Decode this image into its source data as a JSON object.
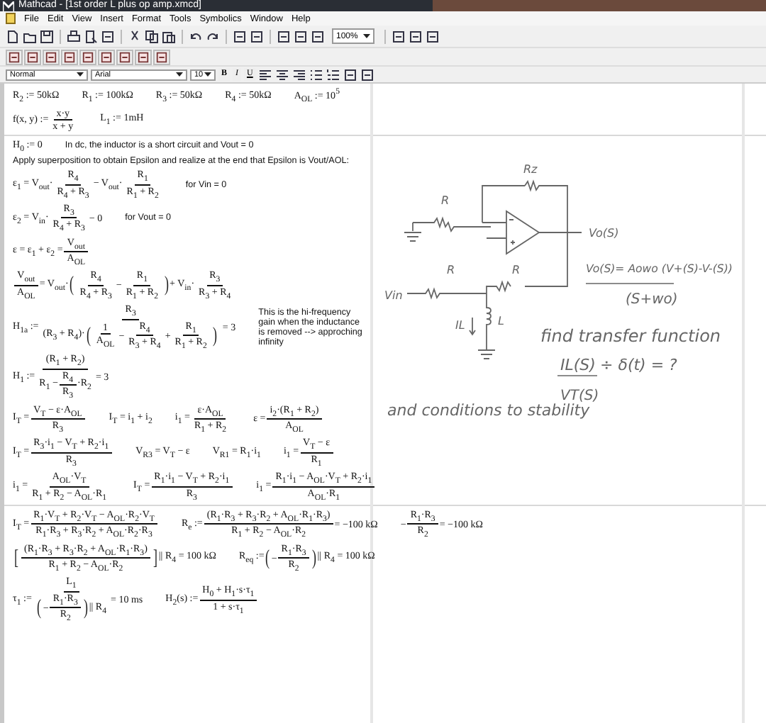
{
  "window": {
    "title": "Mathcad - [1st order L plus op amp.xmcd]"
  },
  "menu": [
    "File",
    "Edit",
    "View",
    "Insert",
    "Format",
    "Tools",
    "Symbolics",
    "Window",
    "Help"
  ],
  "toolbar": {
    "zoom": "100%"
  },
  "format_bar": {
    "style": "Normal",
    "font": "Arial",
    "size": "10",
    "bold": "B",
    "italic": "I",
    "underline": "U"
  },
  "worksheet": {
    "rows": [
      {
        "kind": "row",
        "groups": [
          {
            "kind": "math",
            "parts": [
              {
                "kind": "text",
                "text": "R$_{2}$ := 50kΩ"
              }
            ]
          },
          {
            "kind": "math",
            "parts": [
              {
                "kind": "text",
                "text": "R$_{1}$ := 100kΩ"
              }
            ]
          },
          {
            "kind": "math",
            "parts": [
              {
                "kind": "text",
                "text": "R$_{3}$ := 50kΩ"
              }
            ]
          },
          {
            "kind": "math",
            "parts": [
              {
                "kind": "text",
                "text": "R$_{4}$ := 50kΩ"
              }
            ]
          },
          {
            "kind": "math",
            "parts": [
              {
                "kind": "text",
                "text": "A$_{OL}$ := 10$^{5}$"
              }
            ]
          }
        ]
      },
      {
        "kind": "row",
        "groups": [
          {
            "kind": "math",
            "parts": [
              {
                "kind": "text",
                "text": "f(x, y) := "
              },
              {
                "kind": "frac",
                "num": "x·y",
                "den": "x + y"
              }
            ]
          },
          {
            "kind": "math",
            "parts": [
              {
                "kind": "text",
                "text": "L$_{1}$ := 1mH"
              }
            ]
          }
        ]
      },
      {
        "kind": "break"
      },
      {
        "kind": "row",
        "groups": [
          {
            "kind": "math",
            "parts": [
              {
                "kind": "text",
                "text": "H$_{0}$ := 0"
              }
            ]
          },
          {
            "kind": "note",
            "text": "In dc, the inductor is a short circuit and Vout = 0"
          }
        ]
      },
      {
        "kind": "row",
        "groups": [
          {
            "kind": "note",
            "text": "Apply superposition to obtain Epsilon and realize at the end that Epsilon is Vout/AOL:"
          }
        ]
      },
      {
        "kind": "row",
        "groups": [
          {
            "kind": "math",
            "parts": [
              {
                "kind": "text",
                "text": "ε$_{1}$ = V$_{out}$·"
              },
              {
                "kind": "frac",
                "num": "R$_{4}$",
                "den": "R$_{4}$ + R$_{3}$"
              },
              {
                "kind": "text",
                "text": " − V$_{out}$·"
              },
              {
                "kind": "frac",
                "num": "R$_{1}$",
                "den": "R$_{1}$ + R$_{2}$"
              }
            ]
          },
          {
            "kind": "note",
            "text": "for Vin = 0"
          }
        ]
      },
      {
        "kind": "row",
        "groups": [
          {
            "kind": "math",
            "parts": [
              {
                "kind": "text",
                "text": "ε$_{2}$ = V$_{in}$·"
              },
              {
                "kind": "frac",
                "num": "R$_{3}$",
                "den": "R$_{4}$ + R$_{3}$"
              },
              {
                "kind": "text",
                "text": " − 0"
              }
            ]
          },
          {
            "kind": "note",
            "text": "for Vout = 0"
          }
        ]
      },
      {
        "kind": "row",
        "groups": [
          {
            "kind": "math",
            "parts": [
              {
                "kind": "text",
                "text": "ε = ε$_{1}$ + ε$_{2}$ = "
              },
              {
                "kind": "frac",
                "num": "V$_{out}$",
                "den": "A$_{OL}$"
              }
            ]
          }
        ]
      },
      {
        "kind": "row",
        "groups": [
          {
            "kind": "math",
            "parts": [
              {
                "kind": "frac",
                "num": "V$_{out}$",
                "den": "A$_{OL}$"
              },
              {
                "kind": "text",
                "text": " = V$_{out}$·"
              },
              {
                "kind": "paren",
                "text": "("
              },
              {
                "kind": "frac",
                "num": "R$_{4}$",
                "den": "R$_{4}$ + R$_{3}$"
              },
              {
                "kind": "text",
                "text": " − "
              },
              {
                "kind": "frac",
                "num": "R$_{1}$",
                "den": "R$_{1}$ + R$_{2}$"
              },
              {
                "kind": "paren",
                "text": ")"
              },
              {
                "kind": "text",
                "text": " + V$_{in}$·"
              },
              {
                "kind": "frac",
                "num": "R$_{3}$",
                "den": "R$_{3}$ + R$_{4}$"
              }
            ]
          }
        ]
      },
      {
        "kind": "row",
        "groups": [
          {
            "kind": "math",
            "parts": [
              {
                "kind": "text",
                "text": "H$_{1a}$ := "
              },
              {
                "kind": "frac",
                "num": "R$_{3}$",
                "den": [
                  {
                    "kind": "text",
                    "text": "(R$_{3}$ + R$_{4}$)·"
                  },
                  {
                    "kind": "paren",
                    "text": "("
                  },
                  {
                    "kind": "frac",
                    "num": "1",
                    "den": "A$_{OL}$"
                  },
                  {
                    "kind": "text",
                    "text": " − "
                  },
                  {
                    "kind": "frac",
                    "num": "R$_{4}$",
                    "den": "R$_{3}$ + R$_{4}$"
                  },
                  {
                    "kind": "text",
                    "text": " + "
                  },
                  {
                    "kind": "frac",
                    "num": "R$_{1}$",
                    "den": "R$_{1}$ + R$_{2}$"
                  },
                  {
                    "kind": "paren",
                    "text": ")"
                  }
                ]
              },
              {
                "kind": "text",
                "text": " = 3"
              }
            ]
          },
          {
            "kind": "note",
            "text": "This is the hi-frequency gain when the inductance is removed --> approching infinity"
          }
        ]
      },
      {
        "kind": "row",
        "groups": [
          {
            "kind": "math",
            "parts": [
              {
                "kind": "text",
                "text": "H$_{1}$ := "
              },
              {
                "kind": "frac",
                "num": "(R$_{1}$ + R$_{2}$)",
                "den": [
                  {
                    "kind": "text",
                    "text": "R$_{1}$ − "
                  },
                  {
                    "kind": "frac",
                    "num": "R$_{4}$",
                    "den": "R$_{3}$"
                  },
                  {
                    "kind": "text",
                    "text": "·R$_{2}$"
                  }
                ]
              },
              {
                "kind": "text",
                "text": " = 3"
              }
            ]
          }
        ]
      },
      {
        "kind": "row",
        "groups": [
          {
            "kind": "math",
            "parts": [
              {
                "kind": "text",
                "text": "I$_{T}$ = "
              },
              {
                "kind": "frac",
                "num": "V$_{T}$ − ε·A$_{OL}$",
                "den": "R$_{3}$"
              }
            ]
          },
          {
            "kind": "math",
            "parts": [
              {
                "kind": "text",
                "text": "I$_{T}$ = i$_{1}$ + i$_{2}$"
              }
            ]
          },
          {
            "kind": "math",
            "parts": [
              {
                "kind": "text",
                "text": "i$_{1}$ = "
              },
              {
                "kind": "frac",
                "num": "ε·A$_{OL}$",
                "den": "R$_{1}$ + R$_{2}$"
              }
            ]
          },
          {
            "kind": "math",
            "parts": [
              {
                "kind": "text",
                "text": "ε = "
              },
              {
                "kind": "frac",
                "num": "i$_{2}$·(R$_{1}$ + R$_{2}$)",
                "den": "A$_{OL}$"
              }
            ]
          }
        ]
      },
      {
        "kind": "row",
        "groups": [
          {
            "kind": "math",
            "parts": [
              {
                "kind": "text",
                "text": "I$_{T}$ = "
              },
              {
                "kind": "frac",
                "num": "R$_{3}$·i$_{1}$ − V$_{T}$ + R$_{2}$·i$_{1}$",
                "den": "R$_{3}$"
              }
            ]
          },
          {
            "kind": "math",
            "parts": [
              {
                "kind": "text",
                "text": "V$_{R3}$ = V$_{T}$ − ε"
              }
            ]
          },
          {
            "kind": "math",
            "parts": [
              {
                "kind": "text",
                "text": "V$_{R1}$ = R$_{1}$·i$_{1}$"
              }
            ]
          },
          {
            "kind": "math",
            "parts": [
              {
                "kind": "text",
                "text": "i$_{1}$ = "
              },
              {
                "kind": "frac",
                "num": "V$_{T}$ − ε",
                "den": "R$_{1}$"
              }
            ]
          }
        ]
      },
      {
        "kind": "row",
        "groups": [
          {
            "kind": "math",
            "parts": [
              {
                "kind": "text",
                "text": "i$_{1}$ = "
              },
              {
                "kind": "frac",
                "num": "A$_{OL}$·V$_{T}$",
                "den": "R$_{1}$ + R$_{2}$ − A$_{OL}$·R$_{1}$"
              }
            ]
          },
          {
            "kind": "math",
            "parts": [
              {
                "kind": "text",
                "text": "I$_{T}$ = "
              },
              {
                "kind": "frac",
                "num": "R$_{1}$·i$_{1}$ − V$_{T}$ + R$_{2}$·i$_{1}$",
                "den": "R$_{3}$"
              }
            ]
          },
          {
            "kind": "math",
            "parts": [
              {
                "kind": "text",
                "text": "i$_{1}$ = "
              },
              {
                "kind": "frac",
                "num": "R$_{1}$·i$_{1}$ − A$_{OL}$·V$_{T}$ + R$_{2}$·i$_{1}$",
                "den": "A$_{OL}$·R$_{1}$"
              }
            ]
          }
        ]
      },
      {
        "kind": "break"
      },
      {
        "kind": "row",
        "groups": [
          {
            "kind": "math",
            "parts": [
              {
                "kind": "text",
                "text": "I$_{T}$ = "
              },
              {
                "kind": "frac",
                "num": "R$_{1}$·V$_{T}$ + R$_{2}$·V$_{T}$ − A$_{OL}$·R$_{2}$·V$_{T}$",
                "den": "R$_{1}$·R$_{3}$ + R$_{3}$·R$_{2}$ + A$_{OL}$·R$_{2}$·R$_{3}$"
              }
            ]
          },
          {
            "kind": "math",
            "parts": [
              {
                "kind": "text",
                "text": "R$_{e}$ := "
              },
              {
                "kind": "frac",
                "num": "(R$_{1}$·R$_{3}$ + R$_{3}$·R$_{2}$ + A$_{OL}$·R$_{1}$·R$_{3}$)",
                "den": "R$_{1}$ + R$_{2}$ − A$_{OL}$·R$_{2}$"
              },
              {
                "kind": "text",
                "text": " = −100 kΩ"
              }
            ]
          },
          {
            "kind": "math",
            "parts": [
              {
                "kind": "text",
                "text": "−"
              },
              {
                "kind": "frac",
                "num": "R$_{1}$·R$_{3}$",
                "den": "R$_{2}$"
              },
              {
                "kind": "text",
                "text": " = −100 kΩ"
              }
            ]
          }
        ]
      },
      {
        "kind": "row",
        "groups": [
          {
            "kind": "math",
            "parts": [
              {
                "kind": "paren",
                "text": "["
              },
              {
                "kind": "frac",
                "num": "(R$_{1}$·R$_{3}$ + R$_{3}$·R$_{2}$ + A$_{OL}$·R$_{1}$·R$_{3}$)",
                "den": "R$_{1}$ + R$_{2}$ − A$_{OL}$·R$_{2}$"
              },
              {
                "kind": "paren",
                "text": "]"
              },
              {
                "kind": "text",
                "text": " || R$_{4}$ = 100 kΩ"
              }
            ]
          },
          {
            "kind": "math",
            "parts": [
              {
                "kind": "text",
                "text": "R$_{eq}$ := "
              },
              {
                "kind": "paren",
                "text": "("
              },
              {
                "kind": "text",
                "text": "−"
              },
              {
                "kind": "frac",
                "num": "R$_{1}$·R$_{3}$",
                "den": "R$_{2}$"
              },
              {
                "kind": "paren",
                "text": ")"
              },
              {
                "kind": "text",
                "text": " || R$_{4}$ = 100 kΩ"
              }
            ]
          }
        ]
      },
      {
        "kind": "row",
        "groups": [
          {
            "kind": "math",
            "parts": [
              {
                "kind": "text",
                "text": "τ$_{1}$ := "
              },
              {
                "kind": "frac",
                "num": "L$_{1}$",
                "den": [
                  {
                    "kind": "paren",
                    "text": "("
                  },
                  {
                    "kind": "text",
                    "text": "−"
                  },
                  {
                    "kind": "frac",
                    "num": "R$_{1}$·R$_{3}$",
                    "den": "R$_{2}$"
                  },
                  {
                    "kind": "paren",
                    "text": ")"
                  },
                  {
                    "kind": "text",
                    "text": " || R$_{4}$"
                  }
                ]
              },
              {
                "kind": "text",
                "text": " = 10 ms"
              }
            ]
          },
          {
            "kind": "math",
            "parts": [
              {
                "kind": "text",
                "text": "H$_{2}$(s) := "
              },
              {
                "kind": "frac",
                "num": "H$_{0}$ + H$_{1}$·s·τ$_{1}$",
                "den": "1 + s·τ$_{1}$"
              }
            ]
          }
        ]
      }
    ]
  },
  "sketch": {
    "circuit_labels": [
      "Rz",
      "R",
      "R",
      "R",
      "Vo(S)",
      "Vin",
      "IL",
      "L"
    ],
    "notes": [
      "Vo(S)= Aowo (V+(S)-V-(S))",
      "(S+wo)",
      "find transfer function",
      "IL(S)",
      "VT(S)",
      "÷ δ(t) = ?",
      "and conditions to stability"
    ]
  }
}
